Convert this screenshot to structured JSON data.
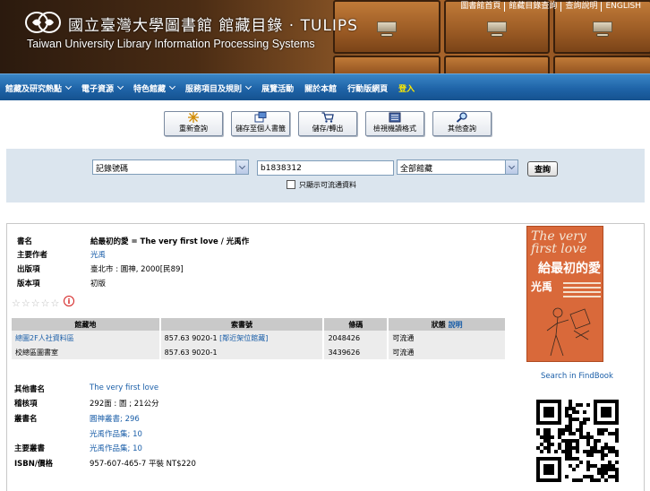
{
  "header": {
    "title_cn": "國立臺灣大學圖書館 館藏目錄 · TULIPS",
    "title_en": "Taiwan University Library Information Processing Systems",
    "top_links": [
      "圖書館首頁",
      "館藏目錄查詢",
      "查詢說明",
      "ENGLISH"
    ]
  },
  "nav": {
    "items": [
      {
        "label": "館藏及研究熱點",
        "chevron": true
      },
      {
        "label": "電子資源",
        "chevron": true
      },
      {
        "label": "特色館藏",
        "chevron": true
      },
      {
        "label": "服務項目及規則",
        "chevron": true
      },
      {
        "label": "展覽活動",
        "chevron": false
      },
      {
        "label": "關於本館",
        "chevron": false
      },
      {
        "label": "行動版網頁",
        "chevron": false
      },
      {
        "label": "登入",
        "chevron": false
      }
    ]
  },
  "toolbar": {
    "buttons": [
      {
        "label": "重新查詢",
        "icon": "new-search-icon"
      },
      {
        "label": "儲存至個人書籤",
        "icon": "bookmark-icon"
      },
      {
        "label": "儲存/轉出",
        "icon": "cart-icon"
      },
      {
        "label": "檢視機讀格式",
        "icon": "marc-icon"
      },
      {
        "label": "其他查詢",
        "icon": "magnifier-icon"
      }
    ]
  },
  "search": {
    "field_select": "記錄號碼",
    "query_value": "b1838312",
    "library_select": "全部館藏",
    "submit_label": "查詢",
    "available_only_label": "只顯示可流通資料"
  },
  "record": {
    "title_label": "書名",
    "title_value": "給最初的愛 = The very first love / 光禹作",
    "author_label": "主要作者",
    "author_value": "光禹",
    "publisher_label": "出版項",
    "publisher_value": "臺北市 : 圓神, 2000[民89]",
    "edition_label": "版本項",
    "edition_value": "初版",
    "holdings_headers": [
      "館藏地",
      "索書號",
      "條碼",
      "狀態 說明"
    ],
    "status_help_link": "說明",
    "holdings": [
      {
        "location": "總圖2F人社資料區",
        "callno": "857.63 9020-1",
        "callno_link": "[鄰近架位館藏]",
        "barcode": "2048426",
        "status": "可流通"
      },
      {
        "location": "校總區圖書室",
        "callno": "857.63 9020-1",
        "callno_link": "",
        "barcode": "3439626",
        "status": "可流通"
      }
    ],
    "other_title_label": "其他書名",
    "other_title_value": "The very first love",
    "physical_label": "稽核項",
    "physical_value": "292面 : 圖 ; 21公分",
    "series_label": "叢書名",
    "series_values": [
      "圓神叢書; 296",
      "光禹作品集; 10"
    ],
    "main_series_label": "主要叢書",
    "main_series_value": "光禹作品集; 10",
    "isbn_label": "ISBN/價格",
    "isbn_value": "957-607-465-7 平裝 NT$220",
    "cover": {
      "title_en": "The very first love",
      "title_cn": "給最初的愛",
      "author": "光禹"
    },
    "findbook_label": "Search in FindBook",
    "rating_stars": 0
  },
  "colors": {
    "nav_blue": "#1f64a8",
    "login_yellow": "#ffea00",
    "search_panel": "#dbe5ee",
    "link_blue": "#1a5ea8"
  }
}
